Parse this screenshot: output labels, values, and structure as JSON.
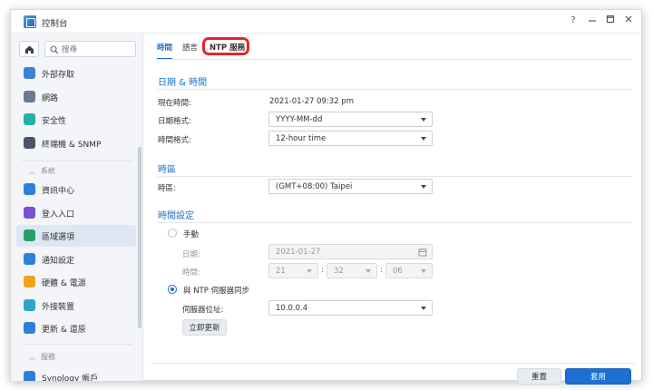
{
  "window": {
    "title": "控制台"
  },
  "titlebar": {
    "help": "?",
    "minimize": "—",
    "maximize": "□",
    "close": "✕"
  },
  "sidebar": {
    "search_placeholder": "搜尋",
    "items_top": [
      {
        "label": "外部存取",
        "icon": "external-access-icon",
        "color": "#3b82d6"
      },
      {
        "label": "網路",
        "icon": "network-icon",
        "color": "#6b7a90"
      },
      {
        "label": "安全性",
        "icon": "security-shield-icon",
        "color": "#27b0a0"
      },
      {
        "label": "終端機 & SNMP",
        "icon": "terminal-icon",
        "color": "#4a5568"
      }
    ],
    "group_system": "系統",
    "items_system": [
      {
        "label": "資訊中心",
        "icon": "info-center-icon",
        "color": "#2f7fd8"
      },
      {
        "label": "登入入口",
        "icon": "login-portal-icon",
        "color": "#7a4fd0"
      },
      {
        "label": "區域選項",
        "icon": "regional-options-icon",
        "color": "#23a267",
        "active": true
      },
      {
        "label": "通知設定",
        "icon": "notification-icon",
        "color": "#2f7fd8"
      },
      {
        "label": "硬體 & 電源",
        "icon": "hardware-power-icon",
        "color": "#f2a21b"
      },
      {
        "label": "外接裝置",
        "icon": "external-devices-icon",
        "color": "#2fa6c8"
      },
      {
        "label": "更新 & 還原",
        "icon": "update-restore-icon",
        "color": "#2f7fd8"
      }
    ],
    "group_services": "服務",
    "items_services": [
      {
        "label": "Synology 帳戶",
        "icon": "synology-account-icon",
        "color": "#2f7fd8"
      }
    ]
  },
  "tabs": [
    {
      "label": "時間",
      "active": true
    },
    {
      "label": "語言",
      "active": false
    },
    {
      "label": "NTP 服務",
      "active": false
    }
  ],
  "date_time": {
    "section_title": "日期 & 時間",
    "current_time_label": "現在時間:",
    "current_time_value": "2021-01-27 09:32 pm",
    "date_format_label": "日期格式:",
    "date_format_value": "YYYY-MM-dd",
    "time_format_label": "時間格式:",
    "time_format_value": "12-hour time"
  },
  "timezone": {
    "section_title": "時區",
    "label": "時區:",
    "value": "(GMT+08:00) Taipei"
  },
  "time_settings": {
    "section_title": "時間設定",
    "manual_label": "手動",
    "date_label": "日期:",
    "date_value": "2021-01-27",
    "time_label": "時間:",
    "hour": "21",
    "minute": "32",
    "second": "06",
    "colon": ":",
    "ntp_label": "與 NTP 伺服器同步",
    "server_label": "伺服器位址:",
    "server_value": "10.0.0.4",
    "update_now": "立即更新",
    "mode": "ntp"
  },
  "footer": {
    "reset": "重置",
    "apply": "套用"
  },
  "colors": {
    "accent": "#1d6fd1",
    "highlight": "#e8242b"
  }
}
